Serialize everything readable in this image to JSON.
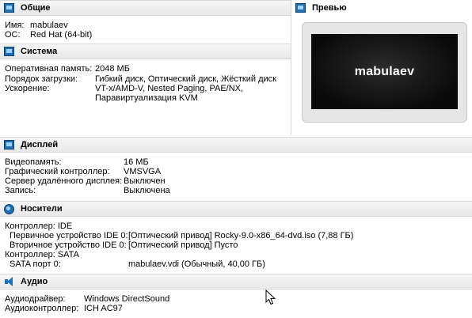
{
  "general": {
    "title": "Общие",
    "rows": [
      {
        "label": "Имя:",
        "value": "mabulaev"
      },
      {
        "label": "ОС:",
        "value": "Red Hat (64-bit)"
      }
    ]
  },
  "preview": {
    "title": "Превью",
    "screen_text": "mabulaev"
  },
  "system": {
    "title": "Система",
    "rows": [
      {
        "label": "Оперативная память:",
        "value": "2048 МБ"
      },
      {
        "label": "Порядок загрузки:",
        "value": "Гибкий диск, Оптический диск, Жёсткий диск"
      },
      {
        "label": "Ускорение:",
        "value": "VT-x/AMD-V, Nested Paging, PAE/NX,"
      },
      {
        "label": "",
        "value": "Паравиртуализация KVM"
      }
    ]
  },
  "display": {
    "title": "Дисплей",
    "rows": [
      {
        "label": "Видеопамять:",
        "value": "16 МБ"
      },
      {
        "label": "Графический контроллер:",
        "value": "VMSVGA"
      },
      {
        "label": "Сервер удалённого дисплея:",
        "value": "Выключен"
      },
      {
        "label": "Запись:",
        "value": "Выключена"
      }
    ]
  },
  "storage": {
    "title": "Носители",
    "rows": [
      {
        "label": "Контроллер: IDE",
        "value": ""
      },
      {
        "label": "Первичное устройство IDE 0:",
        "value": "[Оптический привод] Rocky-9.0-x86_64-dvd.iso (7,88 ГБ)"
      },
      {
        "label": "Вторичное устройство IDE 0:",
        "value": "[Оптический привод] Пусто"
      },
      {
        "label": "Контроллер: SATA",
        "value": ""
      },
      {
        "label": "SATA порт 0:",
        "value": "mabulaev.vdi (Обычный, 40,00 ГБ)"
      }
    ]
  },
  "audio": {
    "title": "Аудио",
    "rows": [
      {
        "label": "Аудиодрайвер:",
        "value": "Windows DirectSound"
      },
      {
        "label": "Аудиоконтроллер:",
        "value": "ICH AC97"
      }
    ]
  },
  "colors": {
    "icon_blue": "#1f6fb5",
    "header_bg": "#ececec"
  }
}
